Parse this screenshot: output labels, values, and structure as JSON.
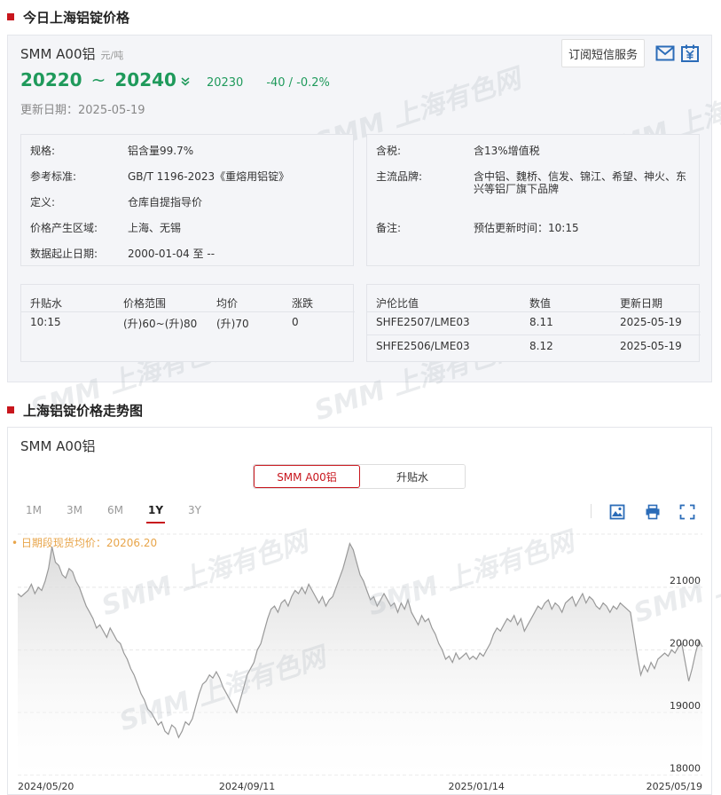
{
  "section1": {
    "title": "今日上海铝锭价格"
  },
  "product": {
    "name": "SMM A00铝",
    "unit": "元/吨"
  },
  "price": {
    "low": "20220",
    "tilde": "~",
    "high": "20240",
    "avg": "20230",
    "change": "-40  /  -0.2%"
  },
  "update_date": "更新日期：2025-05-19",
  "actions": {
    "subscribe_label": "订阅短信服务"
  },
  "icons": {
    "mail": "mail-icon",
    "calendar": "calendar-yuan-icon",
    "down": "double-chevron-down-icon"
  },
  "specs_left": [
    {
      "k": "规格:",
      "v": "铝含量99.7%"
    },
    {
      "k": "参考标准:",
      "v": "GB/T 1196-2023《重熔用铝锭》"
    },
    {
      "k": "定义:",
      "v": "仓库自提指导价"
    },
    {
      "k": "价格产生区域:",
      "v": "上海、无锡"
    },
    {
      "k": "数据起止日期:",
      "v": "2000-01-04 至 --"
    }
  ],
  "specs_right": [
    {
      "k": "含税:",
      "v": "含13%增值税"
    },
    {
      "k": "主流品牌:",
      "v": "含中铝、魏桥、信发、锦江、希望、神火、东",
      "v2": "兴等铝厂旗下品牌"
    },
    {
      "k": "备注:",
      "v": "预估更新时间：10:15"
    }
  ],
  "premium_table": {
    "headers": [
      "升贴水",
      "价格范围",
      "均价",
      "涨跌"
    ],
    "row": [
      "10:15",
      "(升)60~(升)80",
      "(升)70",
      "0"
    ]
  },
  "ratio_table": {
    "headers": [
      "沪伦比值",
      "数值",
      "更新日期"
    ],
    "rows": [
      [
        "SHFE2507/LME03",
        "8.11",
        "2025-05-19"
      ],
      [
        "SHFE2506/LME03",
        "8.12",
        "2025-05-19"
      ]
    ]
  },
  "watermark": "SMM 上海有色网",
  "section2": {
    "title": "上海铝锭价格走势图"
  },
  "chart_panel": {
    "name": "SMM A00铝",
    "segments": [
      "SMM A00铝",
      "升贴水"
    ],
    "active_segment": 0,
    "ranges": [
      "1M",
      "3M",
      "6M",
      "1Y",
      "3Y"
    ],
    "active_range": 3,
    "tools": [
      "image-download-icon",
      "print-icon",
      "fullscreen-icon"
    ],
    "avg_legend": "• 日期段现货均价：20206.20"
  },
  "colors": {
    "accent": "#c8161d",
    "down_green": "#1f9a5b",
    "avg_orange": "#e8a54a",
    "line": "#999999"
  },
  "chart_data": {
    "type": "area",
    "title": "SMM A00铝",
    "x_ticks": [
      "2024/05/20",
      "2024/09/11",
      "2025/01/14",
      "2025/05/19"
    ],
    "y_ticks": [
      18000,
      19000,
      20000,
      21000
    ],
    "ylim": [
      17950,
      21850
    ],
    "grid": true,
    "avg_line": 20206.2,
    "series": [
      {
        "values": [
          20900,
          20850,
          20900,
          20950,
          21050,
          20900,
          21000,
          20950,
          21100,
          21300,
          21650,
          21400,
          21350,
          21200,
          21150,
          21300,
          21250,
          21100,
          21000,
          20850,
          20700,
          20600,
          20500,
          20350,
          20400,
          20300,
          20200,
          20350,
          20250,
          20150,
          20100,
          19950,
          19850,
          19700,
          19600,
          19450,
          19300,
          19200,
          19050,
          19000,
          18900,
          18800,
          18850,
          18700,
          18650,
          18800,
          18750,
          18600,
          18700,
          18850,
          18800,
          18900,
          19100,
          19300,
          19450,
          19500,
          19600,
          19550,
          19650,
          19550,
          19400,
          19300,
          19200,
          19100,
          19000,
          19200,
          19400,
          19600,
          19700,
          19800,
          20000,
          20100,
          20300,
          20500,
          20650,
          20700,
          20600,
          20750,
          20800,
          20700,
          20850,
          20950,
          20900,
          21000,
          20900,
          21050,
          20950,
          20850,
          20750,
          20850,
          20700,
          20800,
          20850,
          21000,
          21150,
          21300,
          21500,
          21700,
          21600,
          21400,
          21200,
          21100,
          20950,
          20800,
          20850,
          20700,
          20800,
          20900,
          20800,
          20700,
          20750,
          20600,
          20750,
          20650,
          20800,
          20600,
          20500,
          20400,
          20550,
          20450,
          20500,
          20350,
          20250,
          20100,
          20000,
          19850,
          19900,
          19800,
          19950,
          19850,
          19900,
          19950,
          19850,
          19900,
          19850,
          19950,
          19900,
          20000,
          20100,
          20250,
          20350,
          20300,
          20400,
          20500,
          20450,
          20550,
          20400,
          20500,
          20300,
          20400,
          20500,
          20600,
          20700,
          20650,
          20750,
          20800,
          20650,
          20750,
          20700,
          20600,
          20750,
          20800,
          20850,
          20700,
          20800,
          20900,
          20750,
          20850,
          20800,
          20700,
          20650,
          20750,
          20700,
          20600,
          20700,
          20650,
          20750,
          20700,
          20650,
          20600,
          20250,
          19900,
          19600,
          19750,
          19650,
          19800,
          19700,
          19850,
          19900,
          19950,
          19900,
          20000,
          19950,
          20050,
          20100,
          19800,
          19500,
          19700,
          19950,
          20150,
          20050
        ]
      }
    ]
  }
}
